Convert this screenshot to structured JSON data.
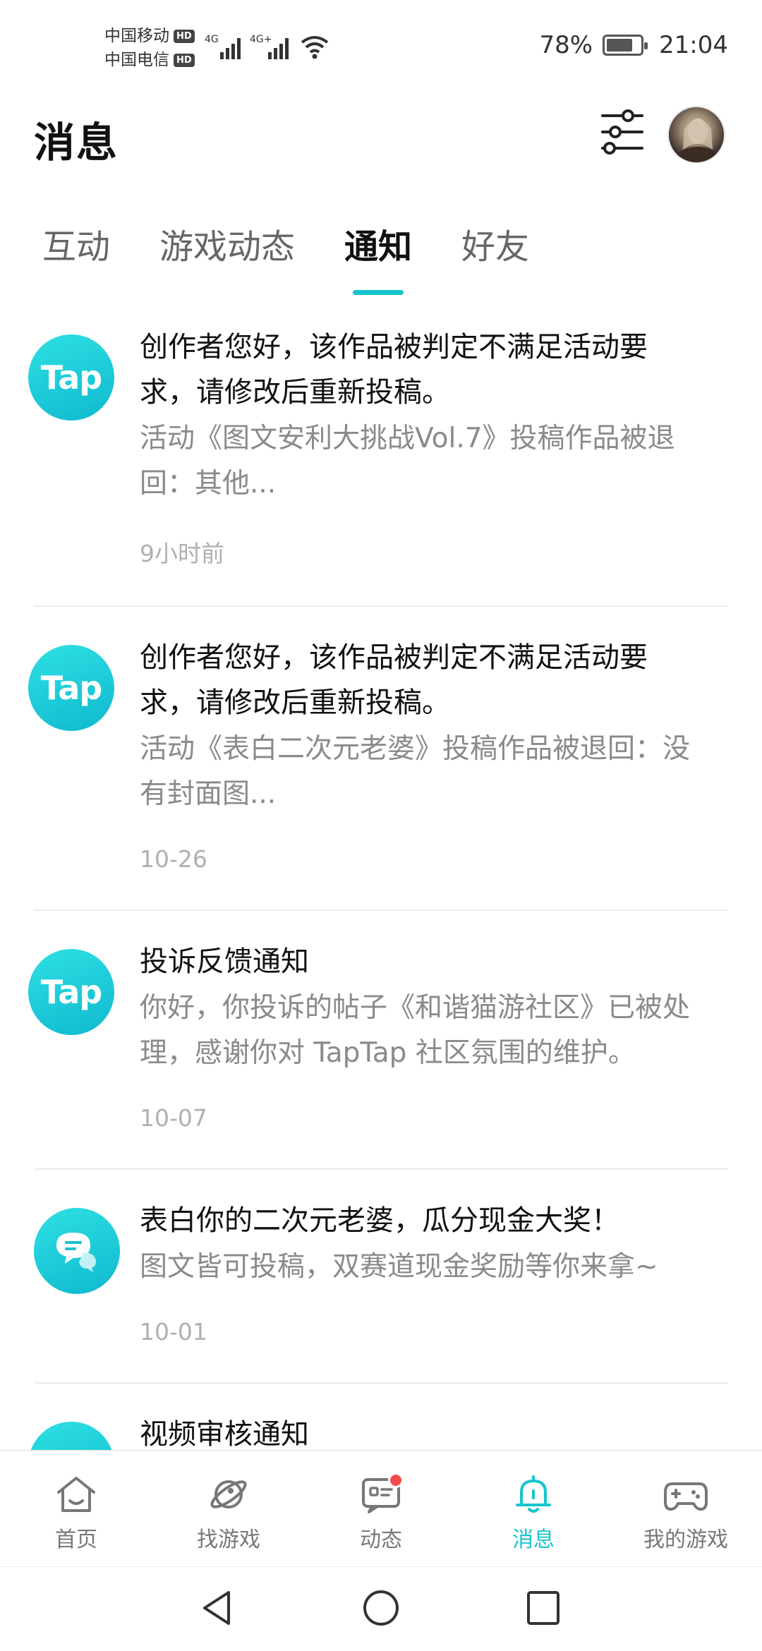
{
  "status_bar": {
    "carrier1": "中国移动",
    "carrier2": "中国电信",
    "hd_badge": "HD",
    "network1": "4G",
    "network2": "4G+",
    "battery_level": 0.78,
    "battery_text": "78%",
    "time": "21:04"
  },
  "header": {
    "title": "消息",
    "filter_icon": "sliders-icon",
    "avatar_icon": "user-avatar"
  },
  "tabs": [
    {
      "label": "互动",
      "active": false
    },
    {
      "label": "游戏动态",
      "active": false
    },
    {
      "label": "通知",
      "active": true
    },
    {
      "label": "好友",
      "active": false
    }
  ],
  "notifications": [
    {
      "icon": "Tap",
      "title": "创作者您好，该作品被判定不满足活动要求，请修改后重新投稿。",
      "desc": "活动《图文安利大挑战Vol.7》投稿作品被退回：其他...",
      "time": "9小时前"
    },
    {
      "icon": "Tap",
      "title": "创作者您好，该作品被判定不满足活动要求，请修改后重新投稿。",
      "desc": "活动《表白二次元老婆》投稿作品被退回：没有封面图...",
      "time": "10-26"
    },
    {
      "icon": "Tap",
      "title": "投诉反馈通知",
      "desc": "你好，你投诉的帖子《和谐猫游社区》已被处理，感谢你对 TapTap 社区氛围的维护。",
      "time": "10-07"
    },
    {
      "icon": "chat-bubble-icon",
      "title": "表白你的二次元老婆，瓜分现金大奖！",
      "desc": "图文皆可投稿，双赛道现金奖励等你来拿~",
      "time": "10-01"
    },
    {
      "icon": "Tap",
      "title": "视频审核通知",
      "desc": "",
      "time": ""
    }
  ],
  "bottom_nav": [
    {
      "label": "首页",
      "icon": "home-icon",
      "active": false
    },
    {
      "label": "找游戏",
      "icon": "planet-icon",
      "active": false
    },
    {
      "label": "动态",
      "icon": "feed-icon",
      "active": false,
      "badge": true
    },
    {
      "label": "消息",
      "icon": "bell-icon",
      "active": true
    },
    {
      "label": "我的游戏",
      "icon": "gamepad-icon",
      "active": false
    }
  ],
  "colors": {
    "accent": "#15c5ce",
    "badge": "#f34b4b"
  }
}
